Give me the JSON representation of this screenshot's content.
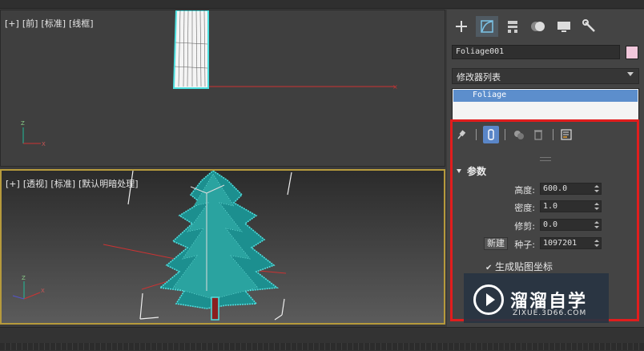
{
  "viewport_top": {
    "labels": [
      "[+]",
      "[前]",
      "[标准]",
      "[线框]"
    ]
  },
  "viewport_perspective": {
    "labels": [
      "[+]",
      "[透视]",
      "[标准]",
      "[默认明暗处理]"
    ]
  },
  "command_panel": {
    "tabs": [
      {
        "icon": "create-plus-icon",
        "glyph": "+"
      },
      {
        "icon": "modify-icon",
        "glyph": ""
      },
      {
        "icon": "hierarchy-icon",
        "glyph": ""
      },
      {
        "icon": "motion-icon",
        "glyph": ""
      },
      {
        "icon": "display-icon",
        "glyph": ""
      },
      {
        "icon": "utilities-wrench-icon",
        "glyph": ""
      }
    ],
    "active_tab": "modify-icon",
    "object_name": "Foliage001",
    "object_color": "#f2c8dc",
    "modifier_list": "修改器列表",
    "stack_items": [
      "Foliage"
    ],
    "parameters": {
      "title": "参数",
      "height_label": "高度:",
      "height": "600.0",
      "density_label": "密度:",
      "density": "1.0",
      "pruning_label": "修剪:",
      "pruning": "0.0",
      "new_button": "新建",
      "seed_label": "种子:",
      "seed": "1097201",
      "gen_map_coords": "生成贴图坐标",
      "gen_map_coords_checked": true
    }
  },
  "watermark": {
    "brand": "溜溜自学",
    "url": "ZIXUE.3D66.COM"
  },
  "colors": {
    "highlight_frame": "#e11d1d",
    "active_viewport_border": "#b69a3c",
    "selection_cyan": "#4de0e0",
    "stack_selection": "#5c8ecc"
  }
}
